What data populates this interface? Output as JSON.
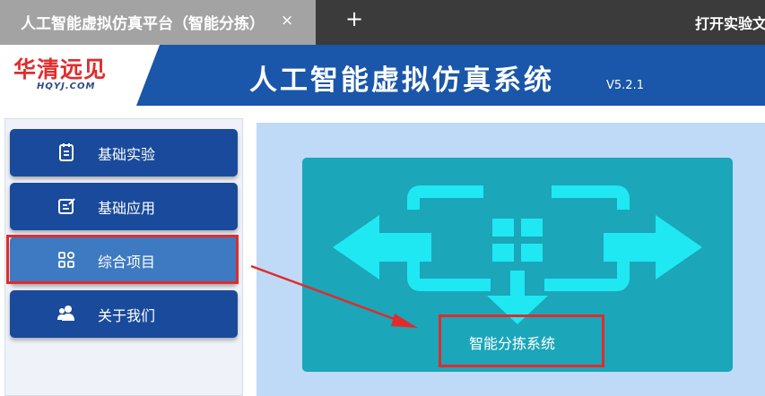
{
  "browser": {
    "tab_title": "人工智能虚拟仿真平台（智能分拣）",
    "tab_close": "×",
    "new_tab": "+",
    "right_action": "打开实验文"
  },
  "header": {
    "logo_main": "华清远见",
    "logo_sub": "HQYJ.COM",
    "title": "人工智能虚拟仿真系统",
    "version": "V5.2.1"
  },
  "sidebar": {
    "items": [
      {
        "label": "基础实验",
        "icon": "notebook-icon"
      },
      {
        "label": "基础应用",
        "icon": "edit-note-icon"
      },
      {
        "label": "综合项目",
        "icon": "apps-grid-icon",
        "active": true
      },
      {
        "label": "关于我们",
        "icon": "users-icon"
      }
    ]
  },
  "main": {
    "card_label": "智能分拣系统",
    "card_icon": "sorting-arrows-icon"
  },
  "colors": {
    "tab_bar": "#3b3b3b",
    "active_tab": "#a3a3a3",
    "header": "#1a56a9",
    "sidebar_button": "#1a4a9b",
    "sidebar_button_active": "#3e7ac1",
    "main_panel": "#bfdaf6",
    "card": "#1ba6ba",
    "card_icon": "#1fe8f3",
    "highlight": "#e12b2b"
  }
}
